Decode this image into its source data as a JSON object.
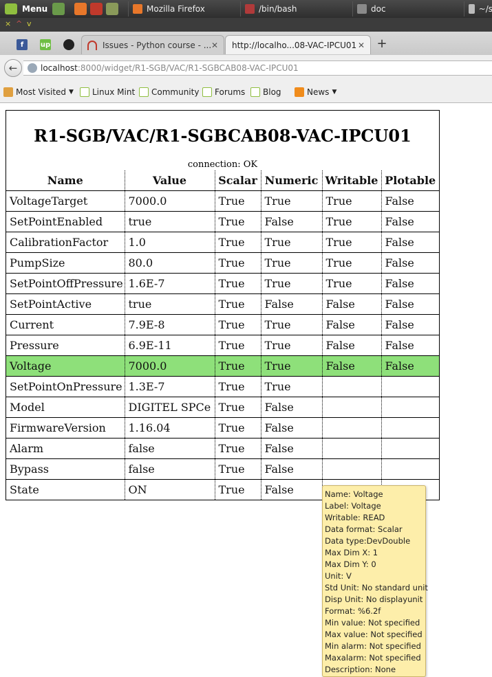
{
  "taskbar": {
    "menu_label": "Menu",
    "tasks": [
      {
        "icon": "firefox-icon",
        "label": "Mozilla Firefox"
      },
      {
        "icon": "terminal-icon",
        "label": "/bin/bash"
      },
      {
        "icon": "folder-icon",
        "label": "doc"
      },
      {
        "icon": "editor-icon",
        "label": "~/s"
      }
    ]
  },
  "browser": {
    "tabs": [
      {
        "label": "Issues - Python course - ...",
        "active": false
      },
      {
        "label": "http://localho...08-VAC-IPCU01",
        "active": true
      }
    ],
    "url": {
      "host": "localhost",
      "path": ":8000/widget/R1-SGB/VAC/R1-SGBCAB08-VAC-IPCU01"
    },
    "bookmarks": [
      "Most Visited",
      "Linux Mint",
      "Community",
      "Forums",
      "Blog",
      "News"
    ]
  },
  "widget": {
    "title": "R1-SGB/VAC/R1-SGBCAB08-VAC-IPCU01",
    "connection": "connection: OK",
    "columns": [
      "Name",
      "Value",
      "Scalar",
      "Numeric",
      "Writable",
      "Plotable"
    ],
    "rows": [
      [
        "VoltageTarget",
        "7000.0",
        "True",
        "True",
        "True",
        "False"
      ],
      [
        "SetPointEnabled",
        "true",
        "True",
        "False",
        "True",
        "False"
      ],
      [
        "CalibrationFactor",
        "1.0",
        "True",
        "True",
        "True",
        "False"
      ],
      [
        "PumpSize",
        "80.0",
        "True",
        "True",
        "True",
        "False"
      ],
      [
        "SetPointOffPressure",
        "1.6E-7",
        "True",
        "True",
        "True",
        "False"
      ],
      [
        "SetPointActive",
        "true",
        "True",
        "False",
        "False",
        "False"
      ],
      [
        "Current",
        "7.9E-8",
        "True",
        "True",
        "False",
        "False"
      ],
      [
        "Pressure",
        "6.9E-11",
        "True",
        "True",
        "False",
        "False"
      ],
      [
        "Voltage",
        "7000.0",
        "True",
        "True",
        "False",
        "False"
      ],
      [
        "SetPointOnPressure",
        "1.3E-7",
        "True",
        "True",
        "",
        ""
      ],
      [
        "Model",
        "DIGITEL SPCe",
        "True",
        "False",
        "",
        ""
      ],
      [
        "FirmwareVersion",
        "1.16.04",
        "True",
        "False",
        "",
        ""
      ],
      [
        "Alarm",
        "false",
        "True",
        "False",
        "",
        ""
      ],
      [
        "Bypass",
        "false",
        "True",
        "False",
        "",
        ""
      ],
      [
        "State",
        "ON",
        "True",
        "False",
        "",
        ""
      ]
    ],
    "highlight_color": "#8ee07a"
  },
  "tooltip": {
    "lines": [
      "Name: Voltage",
      "Label: Voltage",
      "Writable: READ",
      "Data format: Scalar",
      "Data type:DevDouble",
      "Max Dim X: 1",
      "Max Dim Y: 0",
      "Unit: V",
      "Std Unit: No standard unit",
      "Disp Unit: No displayunit",
      "Format: %6.2f",
      "Min value: Not specified",
      "Max value: Not specified",
      "Min alarm: Not specified",
      "Maxalarm: Not specified",
      "Description: None"
    ]
  }
}
